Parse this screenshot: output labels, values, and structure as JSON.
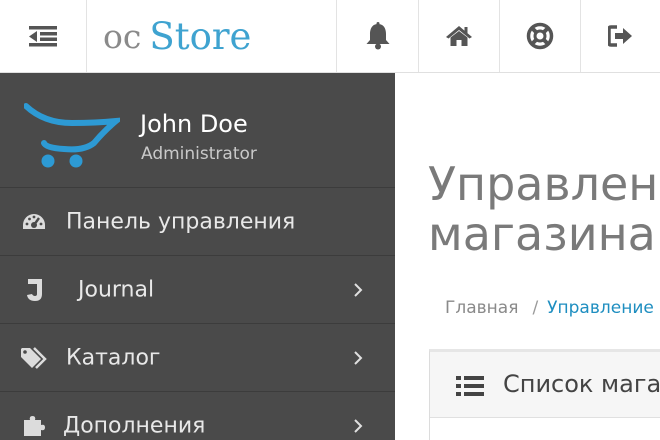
{
  "header": {
    "logo": {
      "oc": "oc",
      "store": "Store"
    },
    "icons": [
      "menu-toggle-icon",
      "bell-icon",
      "home-icon",
      "life-ring-icon",
      "sign-out-icon"
    ]
  },
  "sidebar": {
    "profile": {
      "name": "John Doe",
      "role": "Administrator"
    },
    "items": [
      {
        "label": "Панель управления",
        "icon": "dashboard-icon",
        "has_children": false
      },
      {
        "label": "Journal",
        "icon": "journal-icon",
        "has_children": true
      },
      {
        "label": "Каталог",
        "icon": "tags-icon",
        "has_children": true
      },
      {
        "label": "Дополнения",
        "icon": "puzzle-icon",
        "has_children": true
      }
    ]
  },
  "main": {
    "title_line1": "Управление",
    "title_line2": "магазинами",
    "breadcrumb": {
      "home": "Главная",
      "separator": "/",
      "current": "Управление магазинами"
    },
    "panel": {
      "title": "Список магазинов"
    }
  },
  "colors": {
    "sidebar_bg": "#4a4a4a",
    "accent": "#3fa3d0",
    "link": "#1e8ec0"
  }
}
